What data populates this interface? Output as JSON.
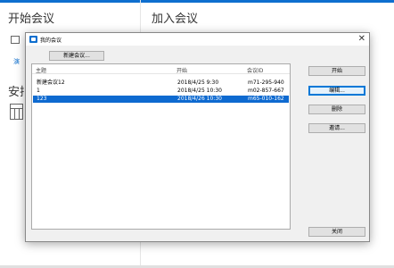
{
  "background": {
    "start_title": "开始会议",
    "join_title": "加入会议",
    "peek_label": "演",
    "section_label": "安排"
  },
  "dialog": {
    "title": "我的会议",
    "close_symbol": "✕",
    "new_meeting_button": "新建会议...",
    "columns": [
      "主题",
      "开始",
      "会议ID"
    ],
    "rows": [
      {
        "subject": "新建会议12",
        "start": "2018/4/25 9:30",
        "meeting_id": "m71-295-940",
        "selected": false
      },
      {
        "subject": "1",
        "start": "2018/4/25 10:30",
        "meeting_id": "m02-857-667",
        "selected": false
      },
      {
        "subject": "123",
        "start": "2018/4/26 10:30",
        "meeting_id": "m65-010-162",
        "selected": true
      }
    ],
    "buttons": {
      "start": "开始",
      "edit": "编辑...",
      "delete": "删除",
      "invite": "邀请...",
      "close": "关闭"
    }
  },
  "colors": {
    "accent": "#0e6fcf",
    "selection": "#0e6ad0"
  }
}
